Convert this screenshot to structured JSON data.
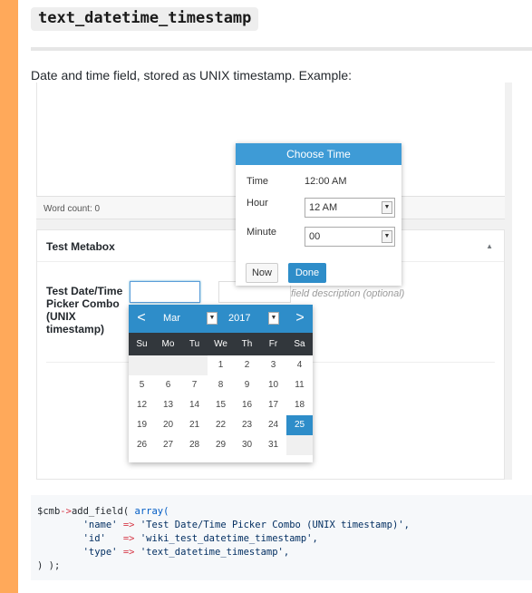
{
  "heading": "text_datetime_timestamp",
  "description": "Date and time field, stored as UNIX timestamp. Example:",
  "screenshot": {
    "word_count": "Word count: 0",
    "metabox_title": "Test Metabox",
    "field_label": "Test Date/Time Picker Combo (UNIX timestamp)",
    "field_description": "field description (optional)",
    "datepicker": {
      "month": "Mar",
      "year": "2017",
      "prev": "<",
      "next": ">",
      "weekdays": [
        "Su",
        "Mo",
        "Tu",
        "We",
        "Th",
        "Fr",
        "Sa"
      ],
      "weeks": [
        [
          "",
          "",
          "",
          "1",
          "2",
          "3",
          "4"
        ],
        [
          "5",
          "6",
          "7",
          "8",
          "9",
          "10",
          "11"
        ],
        [
          "12",
          "13",
          "14",
          "15",
          "16",
          "17",
          "18"
        ],
        [
          "19",
          "20",
          "21",
          "22",
          "23",
          "24",
          "25"
        ],
        [
          "26",
          "27",
          "28",
          "29",
          "30",
          "31",
          ""
        ]
      ],
      "selected_day": "25"
    },
    "timepicker": {
      "title": "Choose Time",
      "time_label": "Time",
      "time_value": "12:00 AM",
      "hour_label": "Hour",
      "hour_value": "12 AM",
      "minute_label": "Minute",
      "minute_value": "00",
      "now_label": "Now",
      "done_label": "Done"
    }
  },
  "code": {
    "line1_var": "$cmb",
    "line1_arrow": "->",
    "line1_fn": "add_field( ",
    "line1_kw": "array(",
    "line2_key": "'name'",
    "line2_val": "'Test Date/Time Picker Combo (UNIX timestamp)',",
    "line3_key": "'id'",
    "line3_val": "'wiki_test_datetime_timestamp',",
    "line4_key": "'type'",
    "line4_val": "'text_datetime_timestamp',",
    "line5": ") );",
    "arrow": "=>"
  },
  "colors": {
    "accent": "#2e8dc9",
    "header_blue": "#3e9bd6",
    "border_orange": "#ffa95a"
  }
}
